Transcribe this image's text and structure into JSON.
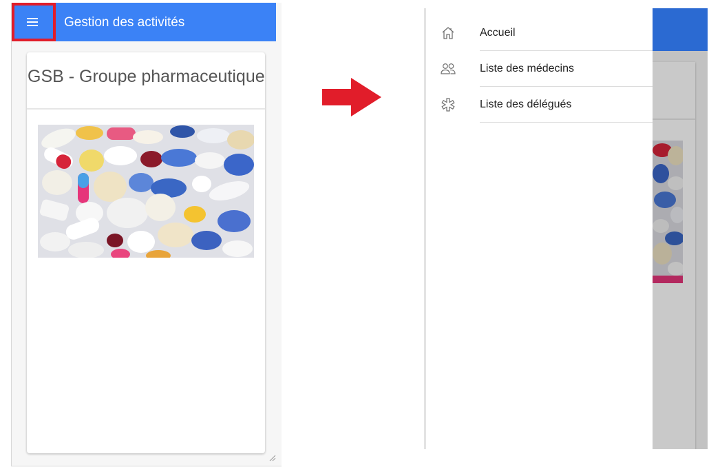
{
  "left_screen": {
    "app_bar": {
      "title": "Gestion des activités",
      "menu_icon": "hamburger-menu-icon"
    },
    "card": {
      "title": "GSB - Groupe pharmaceutique",
      "image": "pills-photo"
    }
  },
  "right_screen": {
    "drawer": {
      "items": [
        {
          "label": "Accueil",
          "icon": "home-icon"
        },
        {
          "label": "Liste des médecins",
          "icon": "people-icon"
        },
        {
          "label": "Liste des délégués",
          "icon": "asterisk-icon"
        }
      ]
    }
  },
  "colors": {
    "app_bar": "#3b82f6",
    "app_bar_dimmed": "#2b6ad2",
    "highlight": "#e11d2a",
    "arrow": "#e11d2a"
  }
}
